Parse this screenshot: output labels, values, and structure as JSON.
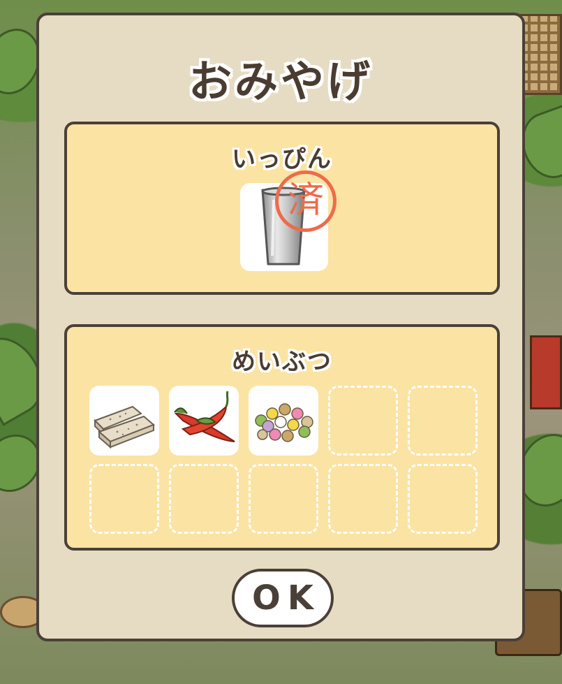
{
  "dialog": {
    "title": "おみやげ",
    "ok_label": "OK"
  },
  "specialty_section": {
    "label": "いっぴん",
    "item": {
      "icon": "steel-tumbler-icon",
      "stamp_text": "済"
    }
  },
  "souvenir_section": {
    "label": "めいぶつ",
    "slots": [
      {
        "filled": true,
        "icon": "rice-cracker-slabs-icon"
      },
      {
        "filled": true,
        "icon": "chili-peppers-icon"
      },
      {
        "filled": true,
        "icon": "colorful-candies-icon"
      },
      {
        "filled": false
      },
      {
        "filled": false
      },
      {
        "filled": false
      },
      {
        "filled": false
      },
      {
        "filled": false
      },
      {
        "filled": false
      },
      {
        "filled": false
      }
    ]
  },
  "colors": {
    "dialog_bg": "#e6dcc3",
    "panel_bg": "#fbe3a4",
    "border": "#4a4038",
    "stamp": "#ee6b4a"
  }
}
